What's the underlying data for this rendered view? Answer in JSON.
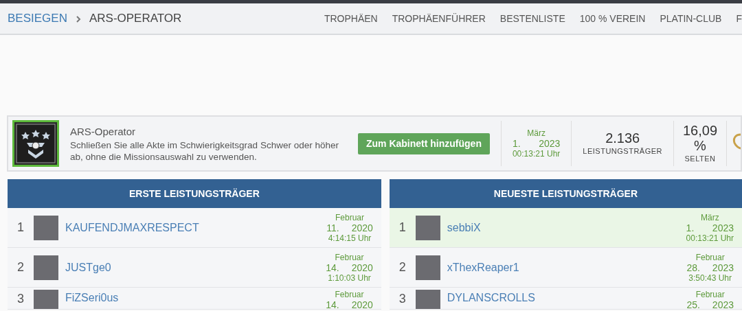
{
  "breadcrumb": [
    {
      "label": "BESIEGEN",
      "kind": "link"
    },
    {
      "label": "ARS-OPERATOR",
      "kind": "current"
    }
  ],
  "nav": [
    "TROPHÄEN",
    "TROPHÄENFÜHRER",
    "BESTENLISTE",
    "100 % VEREIN",
    "PLATIN-CLUB",
    "F"
  ],
  "trophy": {
    "title": "ARS-Operator",
    "description": "Schließen Sie alle Akte im Schwierigkeitsgrad Schwer oder höher ab, ohne die Missionsauswahl zu verwenden.",
    "button": "Zum Kabinett hinzufügen",
    "date": {
      "month": "März",
      "day": "1.",
      "year": "2023",
      "time": "00:13:21 Uhr"
    },
    "achievers": "2.136",
    "achievers_label": "LEISTUNGSTRÄGER",
    "rarity": "16,09",
    "rarity_unit": "%",
    "rarity_label": "SELTEN"
  },
  "tables": [
    {
      "title": "ERSTE LEISTUNGSTRÄGER",
      "rows": [
        {
          "rank": "1",
          "name": "KAUFENDJMAXRESPECT",
          "highlighted": false,
          "date": {
            "month": "Februar",
            "day": "11.",
            "year": "2020",
            "time": "4:14:15 Uhr"
          }
        },
        {
          "rank": "2",
          "name": "JUSTge0",
          "highlighted": false,
          "date": {
            "month": "Februar",
            "day": "14.",
            "year": "2020",
            "time": "1:10:03 Uhr"
          }
        },
        {
          "rank": "3",
          "name": "FiZSeri0us",
          "highlighted": false,
          "date": {
            "month": "Februar",
            "day": "14.",
            "year": "2020"
          }
        }
      ]
    },
    {
      "title": "NEUESTE LEISTUNGSTRÄGER",
      "rows": [
        {
          "rank": "1",
          "name": "sebbiX",
          "highlighted": true,
          "date": {
            "month": "März",
            "day": "1.",
            "year": "2023",
            "time": "00:13:21 Uhr"
          }
        },
        {
          "rank": "2",
          "name": "xThexReaper1",
          "highlighted": false,
          "date": {
            "month": "Februar",
            "day": "28.",
            "year": "2023",
            "time": "3:50:43 Uhr"
          }
        },
        {
          "rank": "3",
          "name": "DYLANSCROLLS",
          "highlighted": false,
          "date": {
            "month": "Februar",
            "day": "25.",
            "year": "2023"
          }
        }
      ]
    }
  ]
}
